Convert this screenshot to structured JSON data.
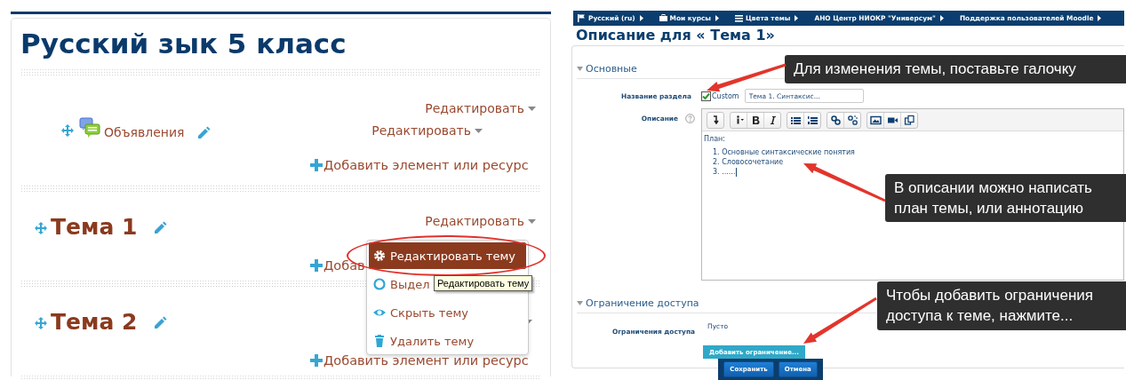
{
  "course_page": {
    "title": "Русский зык 5 класс",
    "sections": [
      {
        "kind": "general",
        "edit_menu": "Редактировать",
        "activities": [
          {
            "name": "Объявления",
            "edit_menu": "Редактировать"
          }
        ],
        "add_link": "Добавить элемент или ресурс"
      },
      {
        "kind": "topic",
        "title": "Тема 1",
        "edit_menu": "Редактировать",
        "add_link": "Добав"
      },
      {
        "kind": "topic",
        "title": "Тема 2",
        "add_link": "Добавить элемент или ресурс"
      }
    ],
    "edit_dropdown": {
      "items": [
        {
          "label": "Редактировать тему",
          "kind": "gear",
          "selected": true
        },
        {
          "label": "Выдел",
          "kind": "circle",
          "selected": false
        },
        {
          "label": "Скрыть тему",
          "kind": "eye",
          "selected": false
        },
        {
          "label": "Удалить тему",
          "kind": "trash",
          "selected": false
        }
      ]
    },
    "tooltip": "Редактировать тему"
  },
  "edit_page": {
    "navbar": [
      {
        "label": "Русский (ru)",
        "kind": "flag"
      },
      {
        "label": "Мои курсы",
        "kind": "briefcase"
      },
      {
        "label": "Цвета темы",
        "kind": "list"
      },
      {
        "label": "АНО Центр НИОКР \"Универсум\"",
        "kind": "none"
      },
      {
        "label": "Поддержка пользователей Moodle",
        "kind": "none"
      }
    ],
    "heading": "Описание для « Тема 1»",
    "general": {
      "legend": "Основные",
      "expanded": true,
      "section_name": {
        "label": "Название раздела",
        "custom_checked": true,
        "custom_label": "Custom",
        "value": "Тема 1. Синтаксис..."
      },
      "description": {
        "label": "Описание",
        "content_title": "План:",
        "list": [
          "1. Основные синтаксические понятия",
          "2. Словосочетание",
          "3. ......"
        ],
        "text_cursor": true
      }
    },
    "restrictions": {
      "legend": "Ограничение доступа",
      "expanded": true,
      "label": "Ограничения доступа",
      "value": "Пусто",
      "add_button": "Добавить ограничение..."
    },
    "buttons": [
      "Сохранить",
      "Отмена"
    ]
  },
  "callouts": [
    {
      "text": "Для изменения темы, поставьте галочку"
    },
    {
      "text": "В описании можно написать план темы, или аннотацию"
    },
    {
      "text": "Чтобы добавить ограничения доступа к теме, нажмите..."
    }
  ]
}
